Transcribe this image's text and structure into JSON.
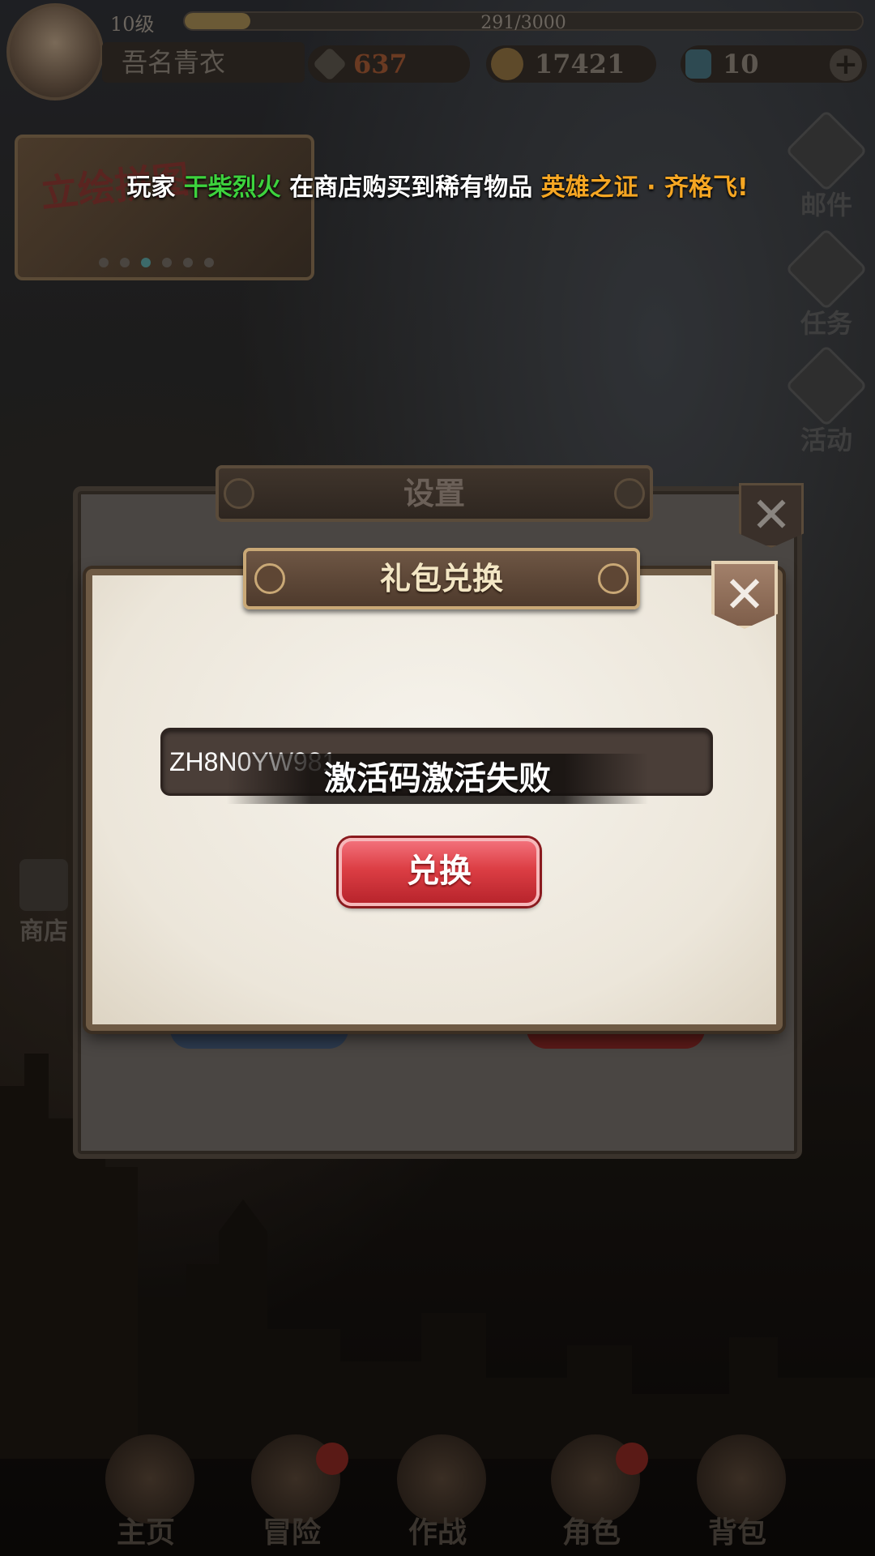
{
  "player": {
    "level": "10级",
    "exp": "291/3000",
    "exp_fraction": 0.097,
    "name": "吾名青衣"
  },
  "resources": {
    "power": "637",
    "gold": "17421",
    "gems": "10",
    "plus_label": "+"
  },
  "banner": {
    "title": "立绘拼图",
    "page_count": 6,
    "active_page": 2
  },
  "marquee": {
    "prefix": "玩家 ",
    "player_name": "干柴烈火",
    "middle": " 在商店购买到稀有物品 ",
    "item_name": "英雄之证 · 齐格飞!"
  },
  "side_buttons": [
    {
      "label": "邮件",
      "icon": "mail-icon"
    },
    {
      "label": "任务",
      "icon": "task-icon"
    },
    {
      "label": "活动",
      "icon": "gift-icon"
    }
  ],
  "shop": {
    "label": "商店",
    "icon": "shop-icon"
  },
  "settings_dialog": {
    "title": "设置",
    "close_label": "✕"
  },
  "gift_dialog": {
    "title": "礼包兑换",
    "close_label": "✕",
    "code_value": "ZH8N0YW981",
    "redeem_label": "兑换"
  },
  "toast": {
    "message": "激活码激活失败"
  },
  "bottom_nav": [
    {
      "label": "主页"
    },
    {
      "label": "冒险"
    },
    {
      "label": "作战"
    },
    {
      "label": "角色"
    },
    {
      "label": "背包"
    }
  ],
  "colors": {
    "marquee_player": "#3dd23d",
    "marquee_item": "#f5a623",
    "redeem_button": "#dc3e44",
    "dialog_paper": "#f6f3ec"
  }
}
